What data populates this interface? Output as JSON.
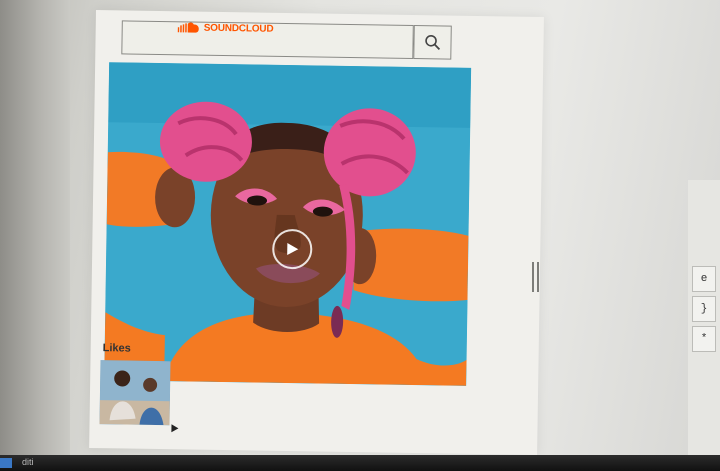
{
  "window": {
    "logo_text": "SOUNDCLOUD",
    "brand_color": "#ff5500"
  },
  "icons": {
    "search": "search-icon",
    "play": "play-icon",
    "logo": "cloud-icon"
  },
  "likes": {
    "label": "Likes"
  },
  "right_panel": {
    "glyphs": [
      "e",
      "}",
      "*"
    ]
  },
  "taskbar": {
    "text": "diti"
  }
}
